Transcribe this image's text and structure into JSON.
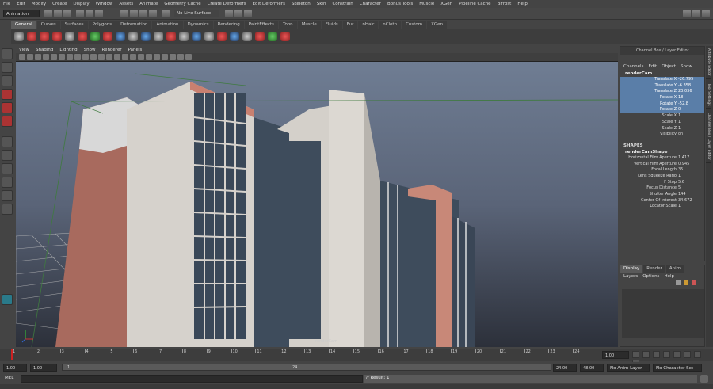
{
  "menubar": [
    "File",
    "Edit",
    "Modify",
    "Create",
    "Display",
    "Window",
    "Assets",
    "Animate",
    "Geometry Cache",
    "Create Deformers",
    "Edit Deformers",
    "Skeleton",
    "Skin",
    "Constrain",
    "Character",
    "Bonus Tools",
    "Muscle",
    "XGen",
    "Pipeline Cache",
    "Bifrost",
    "Help"
  ],
  "status": {
    "menuset": "Animation",
    "live_surface": "No Live Surface"
  },
  "shelf_tabs": [
    "General",
    "Curves",
    "Surfaces",
    "Polygons",
    "Deformation",
    "Animation",
    "Dynamics",
    "Rendering",
    "PaintEffects",
    "Toon",
    "Muscle",
    "Fluids",
    "Fur",
    "nHair",
    "nCloth",
    "Custom",
    "XGen"
  ],
  "shelf_active": "General",
  "viewport_menu": [
    "View",
    "Shading",
    "Lighting",
    "Show",
    "Renderer",
    "Panels"
  ],
  "viewport_label": "renderCam",
  "channel_box": {
    "title": "Channel Box / Layer Editor",
    "menu": [
      "Channels",
      "Edit",
      "Object",
      "Show"
    ],
    "node": "renderCam",
    "attrs": [
      {
        "name": "Translate X",
        "value": "-26.795",
        "selected": true
      },
      {
        "name": "Translate Y",
        "value": "-6.358",
        "selected": true
      },
      {
        "name": "Translate Z",
        "value": "23.036",
        "selected": true
      },
      {
        "name": "Rotate X",
        "value": "18",
        "selected": true
      },
      {
        "name": "Rotate Y",
        "value": "-52.8",
        "selected": true
      },
      {
        "name": "Rotate Z",
        "value": "0",
        "selected": true
      },
      {
        "name": "Scale X",
        "value": "1",
        "selected": false
      },
      {
        "name": "Scale Y",
        "value": "1",
        "selected": false
      },
      {
        "name": "Scale Z",
        "value": "1",
        "selected": false
      },
      {
        "name": "Visibility",
        "value": "on",
        "selected": false
      }
    ],
    "shapes_label": "SHAPES",
    "shape_node": "renderCamShape",
    "shape_attrs": [
      {
        "name": "Horizontal Film Aperture",
        "value": "1.417"
      },
      {
        "name": "Vertical Film Aperture",
        "value": "0.945"
      },
      {
        "name": "Focal Length",
        "value": "35"
      },
      {
        "name": "Lens Squeeze Ratio",
        "value": "1"
      },
      {
        "name": "F Stop",
        "value": "5.6"
      },
      {
        "name": "Focus Distance",
        "value": "5"
      },
      {
        "name": "Shutter Angle",
        "value": "144"
      },
      {
        "name": "Center Of Interest",
        "value": "34.672"
      },
      {
        "name": "Locator Scale",
        "value": "1"
      }
    ]
  },
  "side_tabs": [
    "Attribute Editor",
    "Tool Settings",
    "Channel Box / Layer Editor"
  ],
  "layer_editor": {
    "tabs": [
      "Display",
      "Render",
      "Anim"
    ],
    "menu": [
      "Layers",
      "Options",
      "Help"
    ]
  },
  "timeline": {
    "ticks": [
      "1",
      "2",
      "3",
      "4",
      "5",
      "6",
      "7",
      "8",
      "9",
      "10",
      "11",
      "12",
      "13",
      "14",
      "15",
      "16",
      "17",
      "18",
      "19",
      "20",
      "21",
      "22",
      "23",
      "24"
    ],
    "current_frame": "1.00"
  },
  "range": {
    "start": "1.00",
    "inner_start": "1.00",
    "range_start": "1",
    "range_end": "24",
    "end": "24.00",
    "anim_end": "48.00",
    "anim_layer": "No Anim Layer",
    "character": "No Character Set"
  },
  "command": {
    "label": "MEL",
    "result": "// Result: 1"
  }
}
